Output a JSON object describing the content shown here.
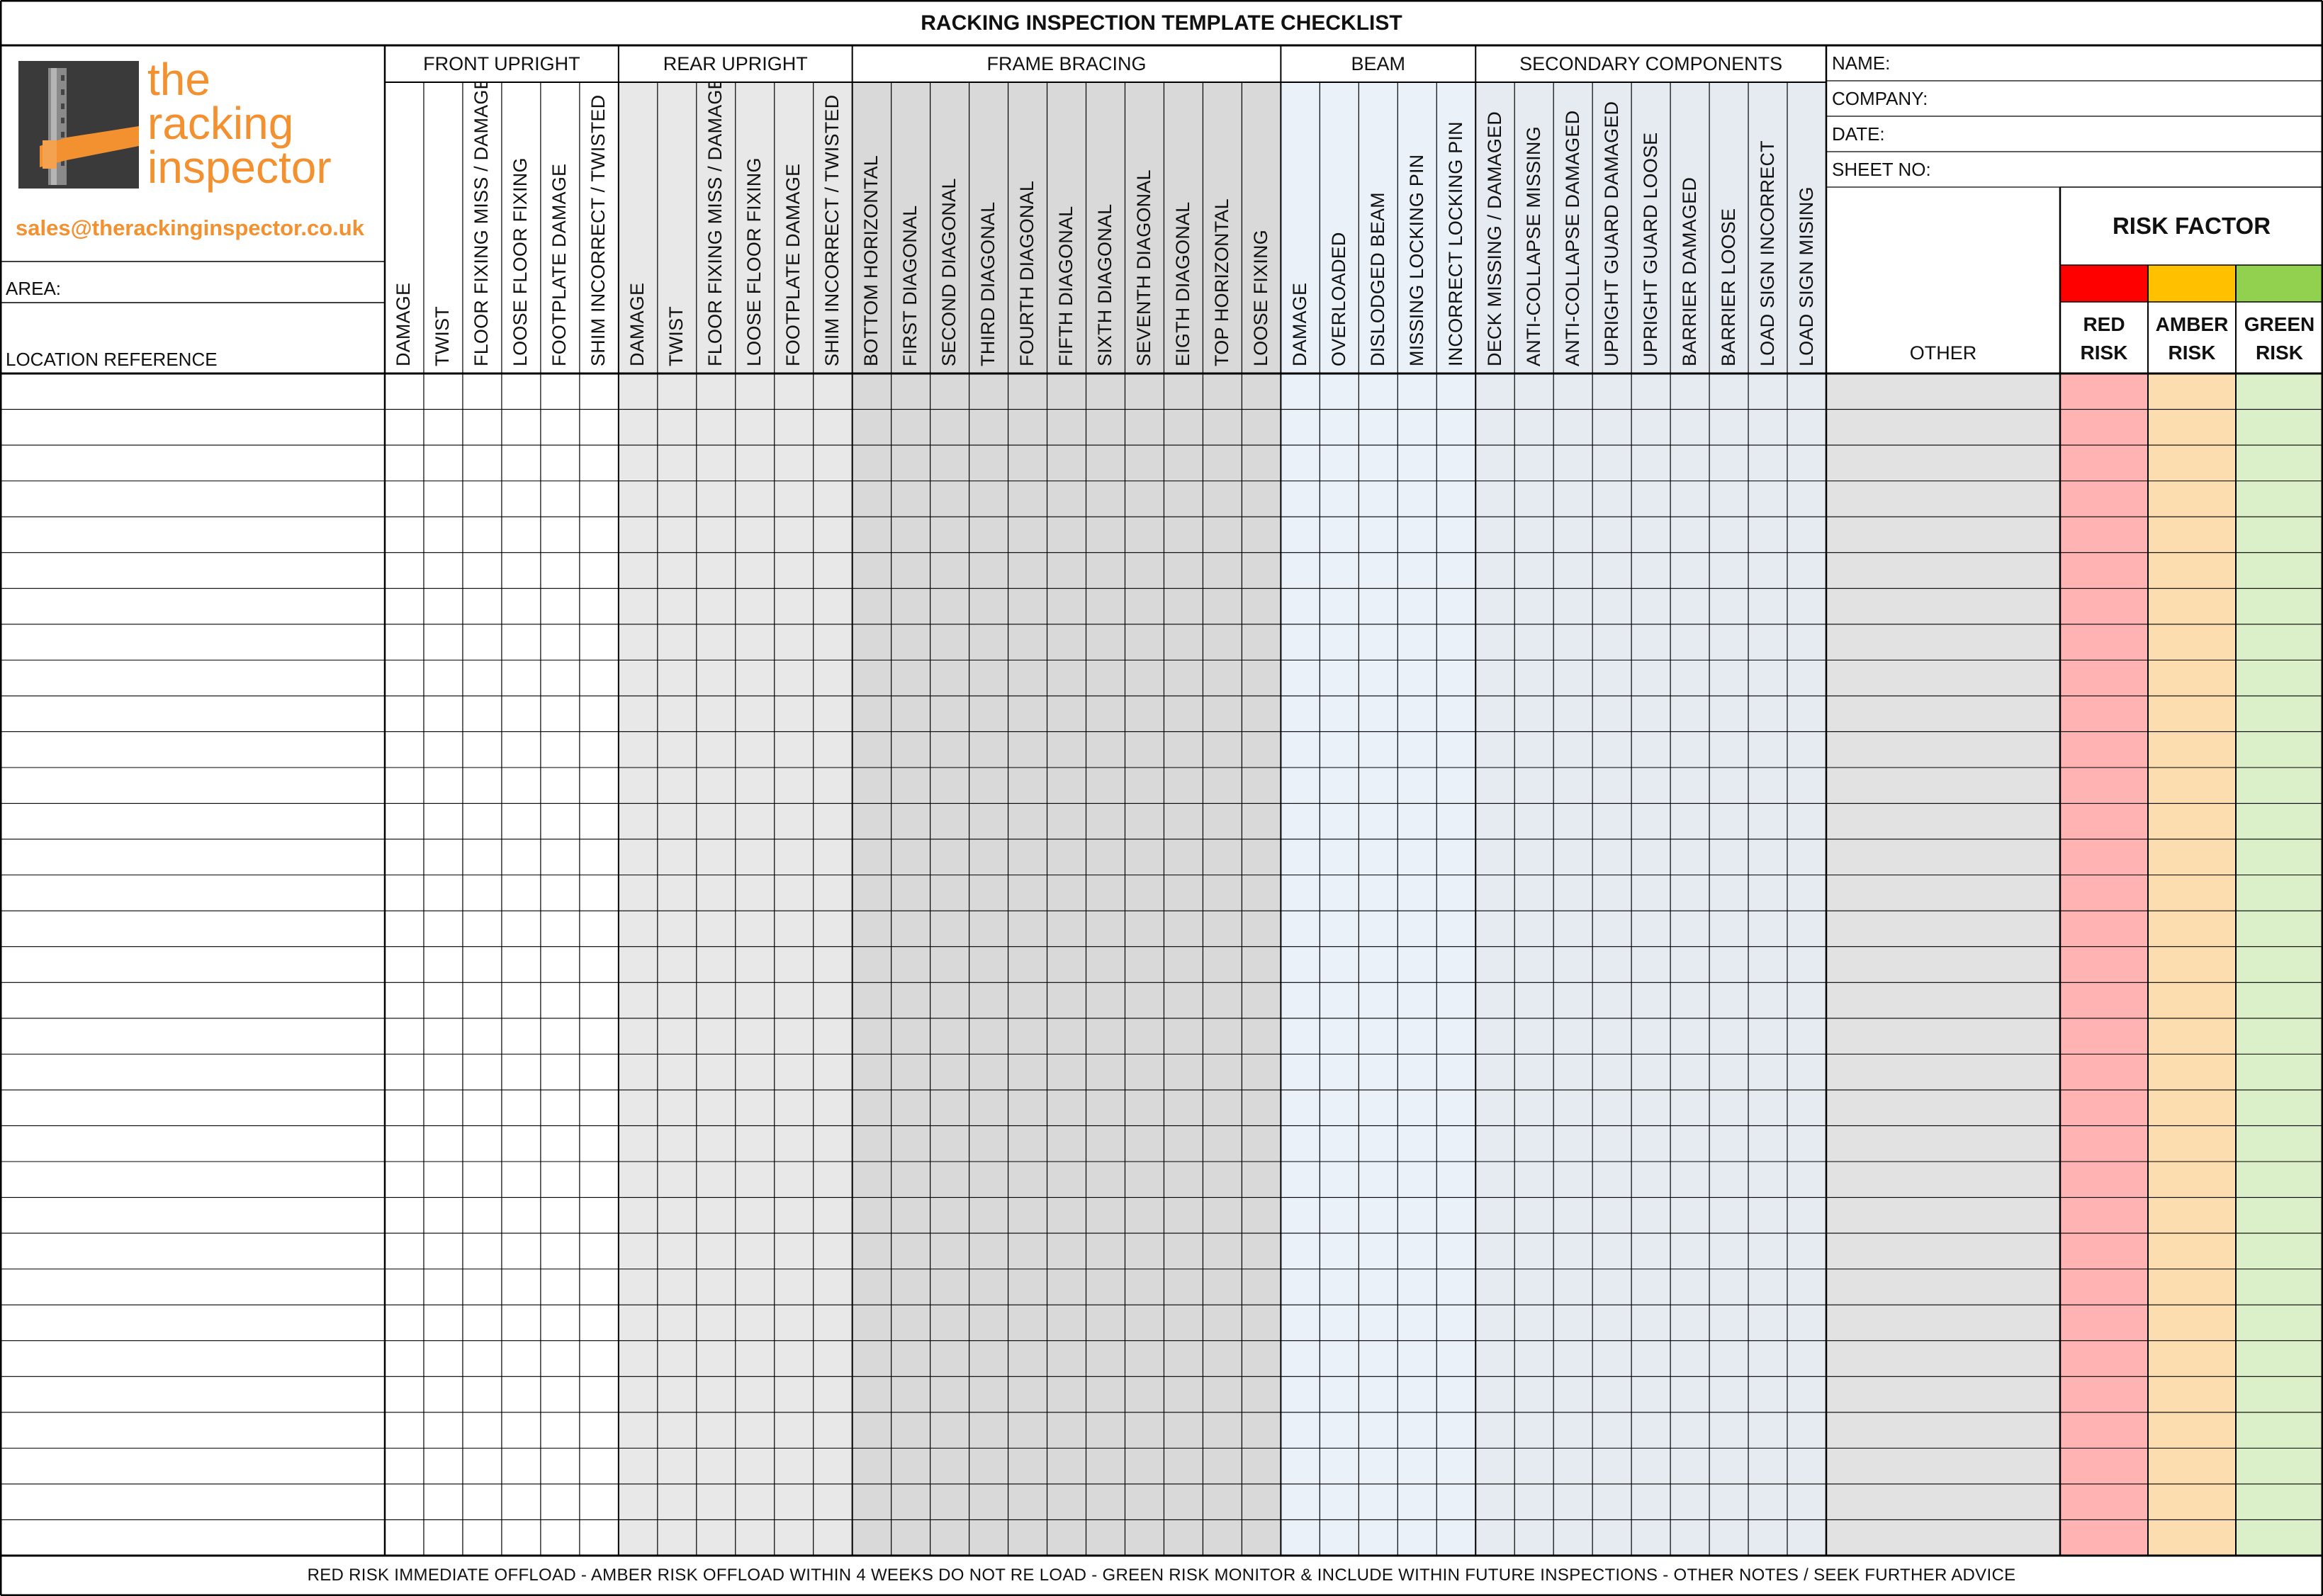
{
  "title": "RACKING INSPECTION TEMPLATE CHECKLIST",
  "logo": {
    "line1": "the",
    "line2": "racking",
    "line3": "inspector",
    "email": "sales@therackinginspector.co.uk",
    "accent": "#f39130",
    "icon": "racking-upright-beam-icon"
  },
  "fields": {
    "area": "AREA:",
    "location": "LOCATION REFERENCE",
    "name": "NAME:",
    "company": "COMPANY:",
    "date": "DATE:",
    "sheet_no": "SHEET NO:"
  },
  "groups": [
    {
      "label": "FRONT UPRIGHT",
      "color": "#ffffff",
      "columns": [
        "DAMAGE",
        "TWIST",
        "FLOOR FIXING MISS / DAMAGE",
        "LOOSE FLOOR FIXING",
        "FOOTPLATE DAMAGE",
        "SHIM INCORRECT / TWISTED"
      ]
    },
    {
      "label": "REAR UPRIGHT",
      "color": "#e8e8e8",
      "columns": [
        "DAMAGE",
        "TWIST",
        "FLOOR FIXING MISS / DAMAGE",
        "LOOSE FLOOR FIXING",
        "FOOTPLATE DAMAGE",
        "SHIM INCORRECT / TWISTED"
      ]
    },
    {
      "label": "FRAME BRACING",
      "color": "#d9d9d9",
      "columns": [
        "BOTTOM HORIZONTAL",
        "FIRST DIAGONAL",
        "SECOND DIAGONAL",
        "THIRD DIAGONAL",
        "FOURTH DIAGONAL",
        "FIFTH DIAGONAL",
        "SIXTH DIAGONAL",
        "SEVENTH DIAGONAL",
        "EIGTH DIAGONAL",
        "TOP HORIZONTAL",
        "LOOSE FIXING"
      ]
    },
    {
      "label": "BEAM",
      "color": "#eaf1f9",
      "columns": [
        "DAMAGE",
        "OVERLOADED",
        "DISLODGED BEAM",
        "MISSING LOCKING PIN",
        "INCORRECT LOCKING PIN"
      ]
    },
    {
      "label": "SECONDARY COMPONENTS",
      "color": "#e6ebf2",
      "columns": [
        "DECK MISSING / DAMAGED",
        "ANTI-COLLAPSE MISSING",
        "ANTI-COLLAPSE DAMAGED",
        "UPRIGHT GUARD DAMAGED",
        "UPRIGHT GUARD LOOSE",
        "BARRIER DAMAGED",
        "BARRIER LOOSE",
        "LOAD SIGN INCORRECT",
        "LOAD SIGN MISING"
      ]
    }
  ],
  "other": {
    "label": "OTHER",
    "color": "#e2e2e2"
  },
  "risk": {
    "header": "RISK FACTOR",
    "levels": [
      {
        "label_top": "RED",
        "label_bottom": "RISK",
        "swatch": "#ff0000",
        "fill": "#ffb3b3"
      },
      {
        "label_top": "AMBER",
        "label_bottom": "RISK",
        "swatch": "#ffc000",
        "fill": "#fbddb0"
      },
      {
        "label_top": "GREEN",
        "label_bottom": "RISK",
        "swatch": "#92d050",
        "fill": "#dbefc9"
      }
    ]
  },
  "rows": 33,
  "footer": "RED RISK IMMEDIATE OFFLOAD - AMBER RISK OFFLOAD WITHIN 4 WEEKS DO NOT RE LOAD - GREEN RISK MONITOR & INCLUDE WITHIN FUTURE INSPECTIONS - OTHER NOTES / SEEK FURTHER ADVICE"
}
